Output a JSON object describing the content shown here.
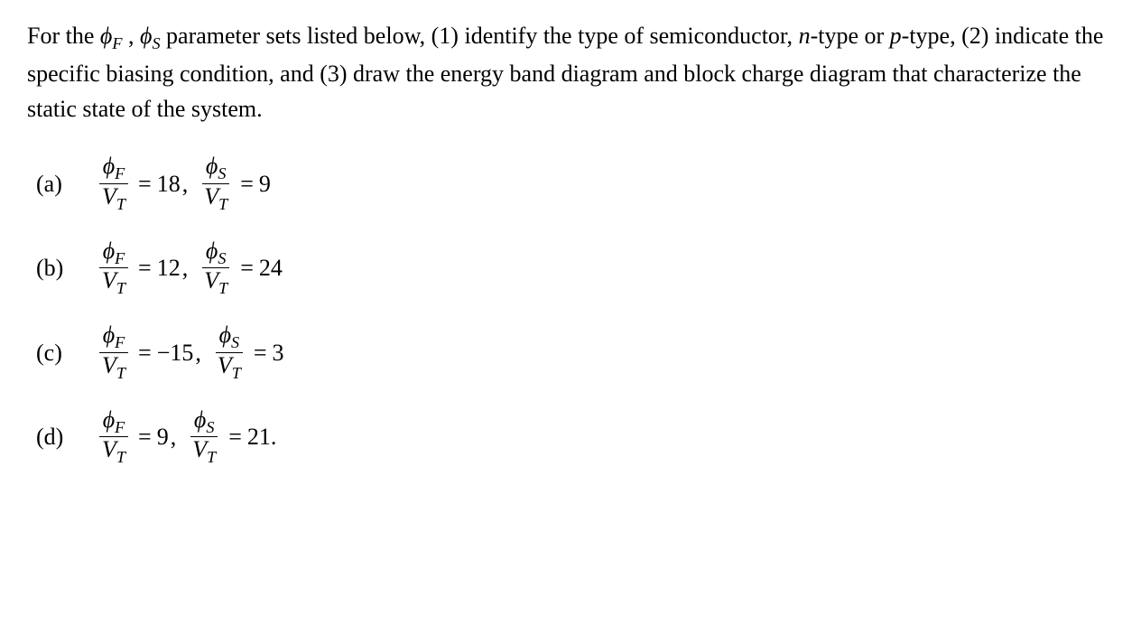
{
  "intro": {
    "t1": "For the ",
    "phi_f": "ϕ",
    "phi_f_sub": "F",
    "sep": " , ",
    "phi_s": "ϕ",
    "phi_s_sub": "S",
    "t2": " parameter sets listed below, (1) identify the type of semiconductor, ",
    "ntype": "n",
    "t3": "-type or ",
    "ptype": "p",
    "t4": "-type, (2) indicate the specific biasing condition, and (3) draw the energy band diagram and block charge diagram that characterize the static state of the system."
  },
  "frac_common": {
    "phiF_num": "ϕ",
    "phiF_sub": "F",
    "phiS_num": "ϕ",
    "phiS_sub": "S",
    "den_V": "V",
    "den_T": "T"
  },
  "items": [
    {
      "label": "(a)",
      "val1": "18",
      "val2": "9",
      "tail": ""
    },
    {
      "label": "(b)",
      "val1": "12",
      "val2": "24",
      "tail": ""
    },
    {
      "label": "(c)",
      "val1": "−15",
      "val2": "3",
      "tail": ""
    },
    {
      "label": "(d)",
      "val1": "9",
      "val2": "21",
      "tail": " ."
    }
  ],
  "symbols": {
    "eq": "=",
    "comma": ","
  }
}
